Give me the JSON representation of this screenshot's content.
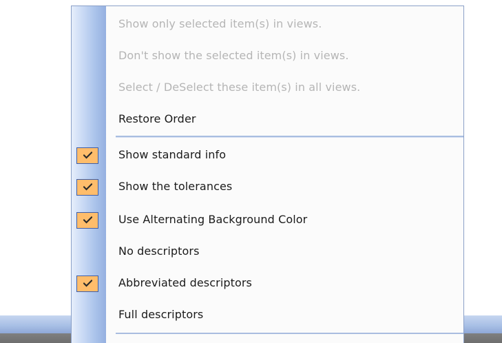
{
  "menu": {
    "items": [
      {
        "label": "Show only selected item(s) in views.",
        "enabled": false,
        "checked": false
      },
      {
        "label": "Don't show the selected item(s) in views.",
        "enabled": false,
        "checked": false
      },
      {
        "label": "Select / DeSelect these item(s) in all views.",
        "enabled": false,
        "checked": false
      },
      {
        "label": "Restore Order",
        "enabled": true,
        "checked": false
      },
      {
        "label": "Show standard info",
        "enabled": true,
        "checked": true
      },
      {
        "label": "Show the tolerances",
        "enabled": true,
        "checked": true
      },
      {
        "label": "Use Alternating Background Color",
        "enabled": true,
        "checked": true
      },
      {
        "label": "No descriptors",
        "enabled": true,
        "checked": false
      },
      {
        "label": "Abbreviated descriptors",
        "enabled": true,
        "checked": true
      },
      {
        "label": "Full descriptors",
        "enabled": true,
        "checked": false
      }
    ]
  },
  "colors": {
    "check_bg": "#ffbd6b",
    "check_border": "#3d5ea8",
    "disabled_text": "#b5b5b5",
    "gutter": "#a9c2ea"
  }
}
